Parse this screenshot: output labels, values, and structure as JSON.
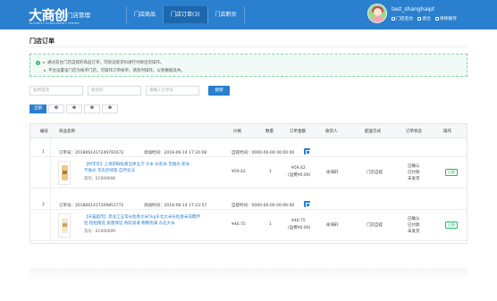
{
  "header": {
    "logo": "大商创",
    "logo_sub": "BUSINESS MANAGEMENT CENTER",
    "shop_mgmt": "门店管理",
    "nav": [
      "门店商品",
      "门店订单(3)",
      "门店职员"
    ],
    "username": "test_shanghaipt",
    "user_links": [
      "门店后台",
      "退出",
      "清除缓存"
    ],
    "brand_color": "#2b7fcf"
  },
  "page": {
    "title": "门店订单",
    "notices": [
      "通过前台门店自提的商品订单，可验证提货码进行付款出货操作。",
      "平台设置该门店为核单门店，可操作订单核单，请及时操作，以免数据丢失。"
    ]
  },
  "filters": {
    "placeholders": [
      "备用电话",
      "提货码",
      "请输入订单号"
    ],
    "search_label": "搜索"
  },
  "tabs": [
    "全部",
    "�",
    "�",
    "�",
    "�"
  ],
  "table": {
    "columns": [
      "编号",
      "商品名称",
      "价格",
      "数量",
      "订单金额",
      "收货人",
      "配送方式",
      "订单状态",
      "操作"
    ],
    "orders": [
      {
        "index": "1",
        "order_no": "订单号：2018061417249781672",
        "added_time": "添加时间：2018-06-14 17:24:08",
        "pickup_time": "自提时间：0000-00-00 00:00:00",
        "product_line1": "【利丰年】上海新鲜稻香当季五万 大米 长剪米 无抛光 新米",
        "product_line2": "不抛光 无农药残留 自然农法",
        "sku": "货号：EC000098",
        "price": "¥59.42",
        "qty": "1",
        "amount": "¥59.42",
        "shipping_fee": "(运费¥0.00)",
        "receiver": "徐海轩",
        "delivery": "门店自提",
        "status": [
          "已确认",
          "已付款",
          "未发货"
        ],
        "action": "日报"
      },
      {
        "index": "2",
        "order_no": "订单号：2018061417309851772",
        "added_time": "添加时间：2018-06-14 17:23:57",
        "pickup_time": "自提时间：0000-00-00 00:00:00",
        "product_line1": "【天猫超市】黑龙江五常长粒香大米5kg东北大米长粒香米非糯伴",
        "product_line2": "侣 粒粒精选 质量保证 香软润滑 颗颗饱满 东北大米",
        "sku": "货号：EC000099",
        "price": "¥46.75",
        "qty": "1",
        "amount": "¥46.75",
        "shipping_fee": "(运费¥0.00)",
        "receiver": "徐海轩",
        "delivery": "门店自提",
        "status": [
          "已确认",
          "已付款",
          "未发货"
        ],
        "action": "日报"
      }
    ]
  }
}
